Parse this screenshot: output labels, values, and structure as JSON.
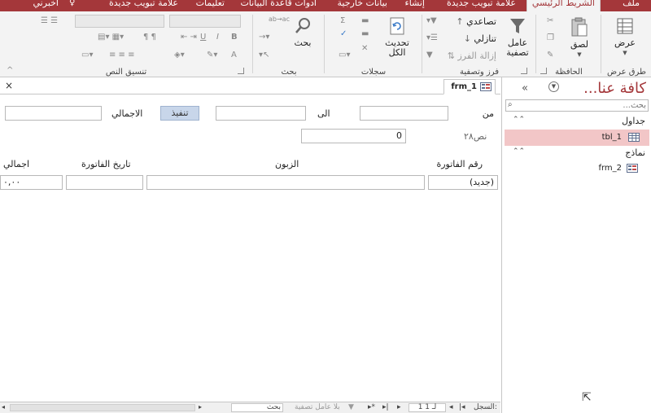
{
  "ribbon_tabs": [
    "ملف",
    "الشريط الرئيسي",
    "علامة تبويب جديدة",
    "إنشاء",
    "بيانات خارجية",
    "أدوات قاعدة البيانات",
    "تعليمات",
    "علامة تبويب جديدة",
    "أخبرني"
  ],
  "ribbon": {
    "views": {
      "button": "عرض",
      "title": "طرق عرض"
    },
    "clipboard": {
      "paste": "لصق",
      "title": "الحافظة"
    },
    "sort_filter": {
      "filter": "عامل تصفية",
      "ascending": "تصاعدي",
      "descending": "تنازلي",
      "remove_sort": "إزالة الفرز",
      "title": "فرز وتصفية"
    },
    "records": {
      "refresh_all": "تحديث الكل",
      "title": "سجلات"
    },
    "find": {
      "find": "بحث",
      "replace_glyph": "ab→ac",
      "title": "بحث"
    },
    "text_format": {
      "title": "تنسيق النص"
    }
  },
  "nav": {
    "title": "كافة عنا...",
    "search_placeholder": "بحث...",
    "sections": [
      {
        "label": "جداول",
        "items": [
          "tbl_1"
        ]
      },
      {
        "label": "نماذج",
        "items": [
          "frm_2"
        ]
      }
    ]
  },
  "document": {
    "tab_title": "frm_1",
    "filter": {
      "from_label": "من",
      "to_label": "الى",
      "execute_button": "تنفيذ",
      "total_label": "الاجمالي",
      "text28_label": "نص٢٨",
      "text28_value": "0"
    },
    "columns": [
      "رقم الفاتورة",
      "الزبون",
      "تاريخ الفاتورة",
      "اجمالي"
    ],
    "new_row": {
      "invoice_no": "(جديد)",
      "total": "٠,٠٠"
    }
  },
  "record_nav": {
    "label": "السجل:",
    "position": "1 لـ 1",
    "no_filter": "بلا عامل تصفية",
    "search": "بحث"
  }
}
